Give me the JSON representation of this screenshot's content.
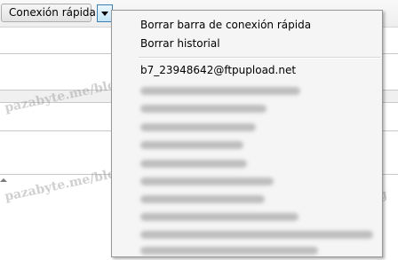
{
  "toolbar": {
    "quickconnect_label": "Conexión rápida"
  },
  "watermark": {
    "text": "pazabyte.me/blog"
  },
  "menu": {
    "items": [
      {
        "label": "Borrar barra de conexión rápida"
      },
      {
        "label": "Borrar historial"
      }
    ],
    "history": [
      {
        "label": "b7_23948642@ftpupload.net"
      }
    ]
  }
}
